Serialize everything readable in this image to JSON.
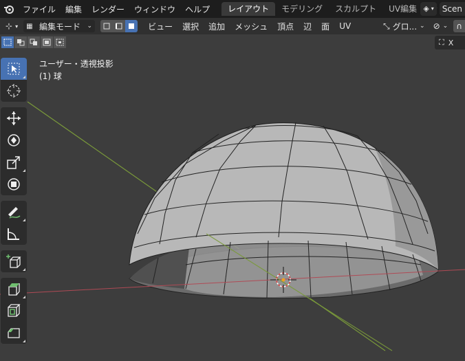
{
  "top_menu": [
    "ファイル",
    "編集",
    "レンダー",
    "ウィンドウ",
    "ヘルプ"
  ],
  "workspaces": [
    {
      "label": "レイアウト",
      "active": true
    },
    {
      "label": "モデリング",
      "active": false
    },
    {
      "label": "スカルプト",
      "active": false
    },
    {
      "label": "UV編集",
      "active": false
    },
    {
      "label": "テ",
      "active": false
    }
  ],
  "scene_label": "Scen",
  "header": {
    "mode": "編集モード",
    "menus": [
      "ビュー",
      "選択",
      "追加",
      "メッシュ",
      "頂点",
      "辺",
      "面",
      "UV"
    ],
    "orientation": "グロ..."
  },
  "nav_label": "X",
  "viewport": {
    "view_name": "ユーザー・透視投影",
    "object_name": "(1) 球"
  },
  "colors": {
    "accent": "#4772b3",
    "background": "#3d3d3d",
    "topbar": "#1d1d1d",
    "x_axis": "#b04a55",
    "y_axis": "#7a9a3a",
    "mesh_outer": "#b9b9b9",
    "mesh_inner": "#9c9c9c"
  },
  "tools": [
    {
      "icon": "select-box-icon",
      "active": true
    },
    {
      "icon": "cursor-icon",
      "active": false
    },
    {
      "icon": "move-icon",
      "active": false
    },
    {
      "icon": "rotate-icon",
      "active": false
    },
    {
      "icon": "scale-icon",
      "active": false
    },
    {
      "icon": "transform-icon",
      "active": false
    },
    {
      "icon": "annotate-icon",
      "active": false
    },
    {
      "icon": "measure-icon",
      "active": false
    },
    {
      "icon": "add-cube-icon",
      "active": false
    },
    {
      "icon": "extrude-icon",
      "active": false
    },
    {
      "icon": "inset-icon",
      "active": false
    },
    {
      "icon": "bevel-icon",
      "active": false
    }
  ]
}
